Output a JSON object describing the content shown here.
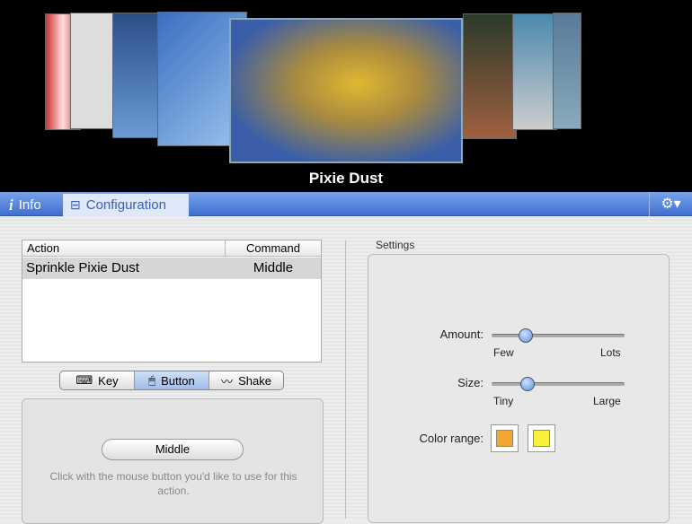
{
  "carousel": {
    "title": "Pixie Dust"
  },
  "tabs": [
    {
      "label": "Info",
      "icon": "info-icon"
    },
    {
      "label": "Configuration",
      "icon": "configuration-icon",
      "selected": true
    }
  ],
  "table": {
    "headers": [
      "Action",
      "Command"
    ],
    "rows": [
      {
        "action": "Sprinkle Pixie Dust",
        "command": "Middle"
      }
    ]
  },
  "trigger_types": [
    {
      "label": "Key"
    },
    {
      "label": "Button",
      "selected": true
    },
    {
      "label": "Shake"
    }
  ],
  "button_panel": {
    "button_label": "Middle",
    "hint": "Click with the mouse button you'd like to use for this action."
  },
  "settings": {
    "title": "Settings",
    "amount": {
      "label": "Amount:",
      "min_label": "Few",
      "max_label": "Lots",
      "value": 0.26
    },
    "size": {
      "label": "Size:",
      "min_label": "Tiny",
      "max_label": "Large",
      "value": 0.27
    },
    "color_range": {
      "label": "Color range:",
      "colors": [
        "#f0a830",
        "#faf03a"
      ]
    }
  }
}
